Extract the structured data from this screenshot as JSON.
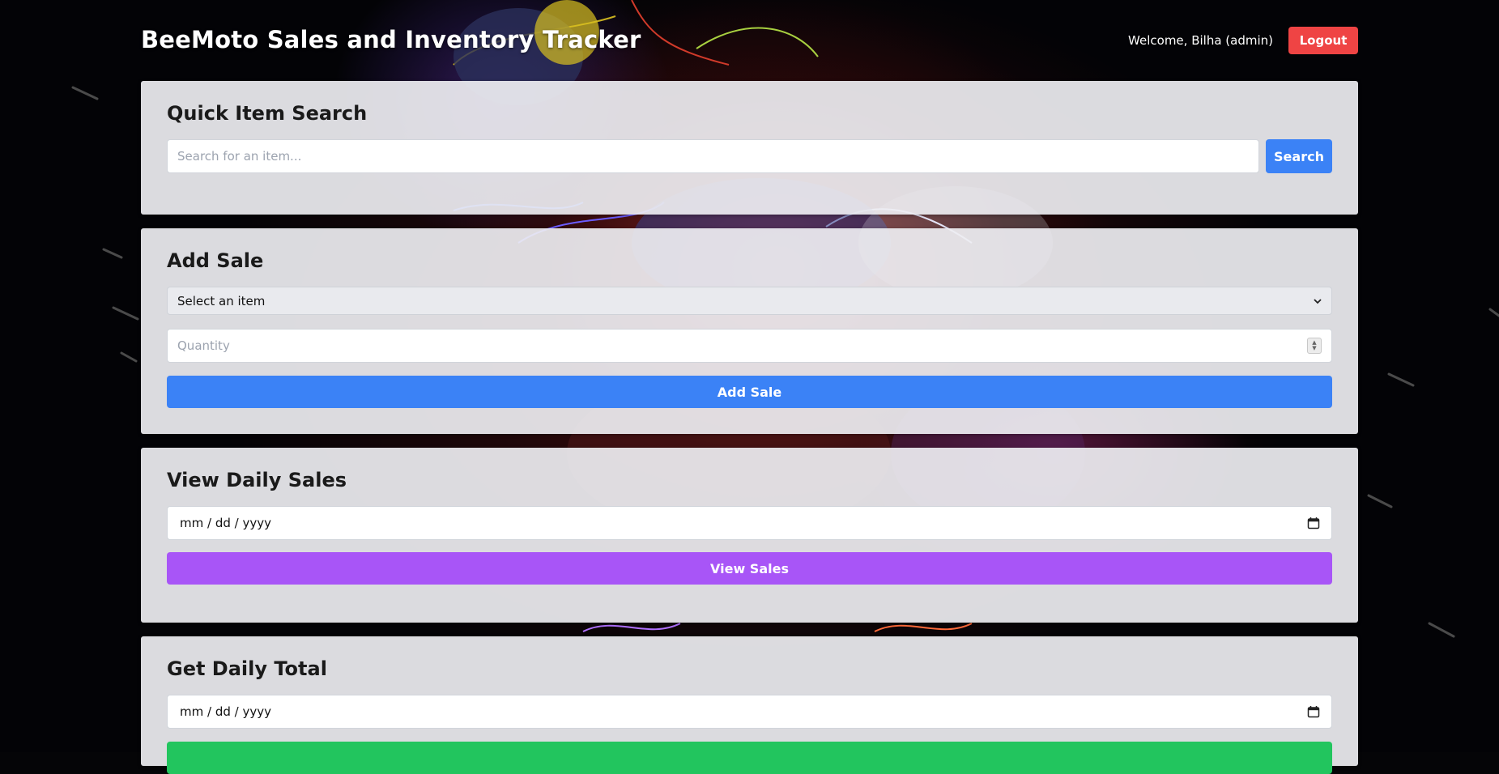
{
  "header": {
    "app_title": "BeeMoto Sales and Inventory Tracker",
    "welcome_text": "Welcome, Bilha (admin)",
    "logout_label": "Logout"
  },
  "quick_search": {
    "title": "Quick Item Search",
    "placeholder": "Search for an item...",
    "button_label": "Search"
  },
  "add_sale": {
    "title": "Add Sale",
    "item_select_value": "Select an item",
    "quantity_placeholder": "Quantity",
    "button_label": "Add Sale"
  },
  "view_daily_sales": {
    "title": "View Daily Sales",
    "date_value": "mm / dd / yyyy",
    "button_label": "View Sales"
  },
  "daily_total": {
    "title": "Get Daily Total",
    "date_value": "mm / dd / yyyy"
  },
  "colors": {
    "primary": "#3b82f6",
    "danger": "#ef4444",
    "purple": "#a855f7",
    "success": "#22c55e"
  },
  "icons": [
    "chevron-down-icon",
    "spinner-icon",
    "calendar-icon"
  ]
}
